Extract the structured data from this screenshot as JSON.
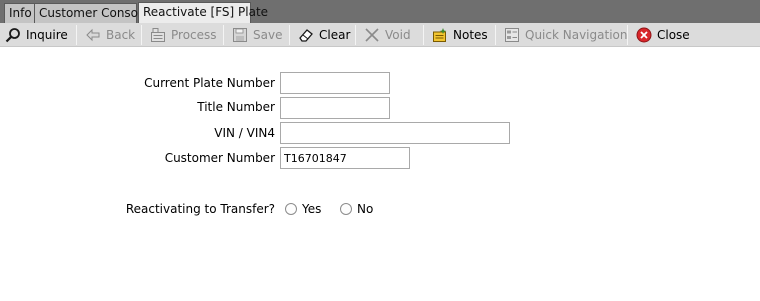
{
  "tabs": [
    {
      "label": "Info"
    },
    {
      "label": "Customer Console"
    },
    {
      "label": "Reactivate [FS] Plate"
    }
  ],
  "toolbar": {
    "inquire": "Inquire",
    "back": "Back",
    "process": "Process",
    "save": "Save",
    "clear": "Clear",
    "void": "Void",
    "notes": "Notes",
    "quick_navigation": "Quick Navigation",
    "close": "Close"
  },
  "form": {
    "current_plate_label": "Current Plate Number",
    "current_plate_value": "",
    "title_number_label": "Title Number",
    "title_number_value": "",
    "vin_label": "VIN / VIN4",
    "vin_value": "",
    "customer_number_label": "Customer Number",
    "customer_number_value": "T16701847",
    "transfer_question": "Reactivating to Transfer?",
    "yes_label": "Yes",
    "no_label": "No"
  },
  "colors": {
    "close_icon": "#d9262a",
    "notes_icon": "#f2c531"
  }
}
